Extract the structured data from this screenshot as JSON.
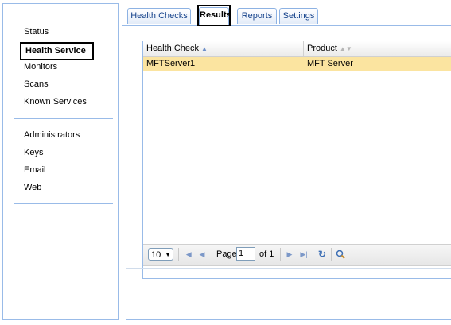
{
  "sidebar": {
    "items_top": [
      {
        "label": "Status",
        "active": false
      },
      {
        "label": "Health Service",
        "active": true
      },
      {
        "label": "Monitors",
        "active": false
      },
      {
        "label": "Scans",
        "active": false
      },
      {
        "label": "Known Services",
        "active": false
      }
    ],
    "items_bottom": [
      {
        "label": "Administrators"
      },
      {
        "label": "Keys"
      },
      {
        "label": "Email"
      },
      {
        "label": "Web"
      }
    ]
  },
  "tabs": [
    {
      "label": "Health Checks",
      "active": false
    },
    {
      "label": "Results",
      "active": true
    },
    {
      "label": "Reports",
      "active": false
    },
    {
      "label": "Settings",
      "active": false
    }
  ],
  "grid": {
    "columns": [
      {
        "label": "Health Check",
        "sort": "ascending"
      },
      {
        "label": "Product",
        "sort": "none"
      }
    ],
    "rows": [
      {
        "health_check": "MFTServer1",
        "product": "MFT Server",
        "selected": true
      }
    ],
    "highlight_color": "#fbe4a0"
  },
  "pager": {
    "page_size": "10",
    "page_label": "Page",
    "current_page": "1",
    "of_label": "of 1"
  },
  "icons": {
    "first": "first-page-icon",
    "prev": "prev-page-icon",
    "next": "next-page-icon",
    "last": "last-page-icon",
    "refresh": "refresh-icon",
    "search": "zoom-search-icon"
  }
}
